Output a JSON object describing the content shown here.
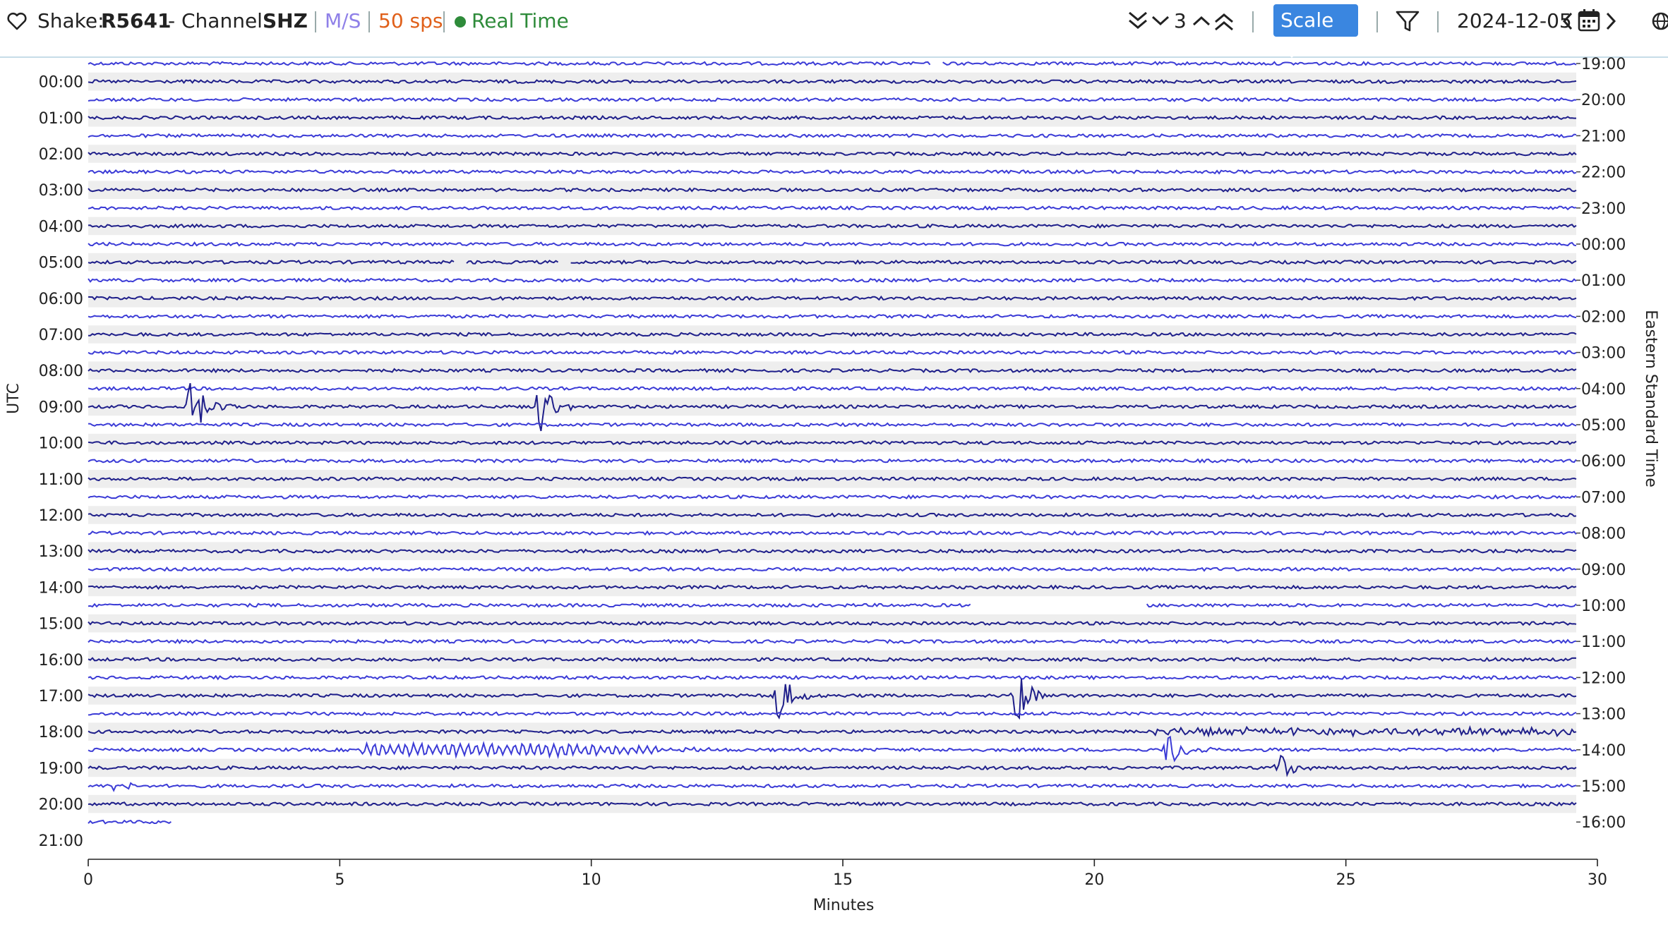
{
  "header": {
    "shake_label": "Shake:",
    "station": "R5641",
    "channel_label": "- Channel:",
    "channel": "SHZ",
    "units": "M/S",
    "rate": "50 sps",
    "mode": "Real Time",
    "lines_count": "3",
    "scale_label": "Scale",
    "date": "2024-12-05",
    "colors": {
      "units": "#8f80e8",
      "rate": "#e0601a",
      "mode": "#2e8b3a",
      "scale_bg": "#3a86e0",
      "trace_dark": "#1f1f8a",
      "trace_light": "#3b3bd6"
    },
    "icons": [
      "heart-icon",
      "double-chevron-down-icon",
      "chevron-down-icon",
      "chevron-up-icon",
      "double-chevron-up-icon",
      "filter-icon",
      "chevron-left-icon",
      "calendar-icon",
      "chevron-right-icon",
      "globe-icon"
    ]
  },
  "chart_data": {
    "type": "line",
    "title": "",
    "xlabel": "Minutes",
    "ylabel_left": "UTC",
    "ylabel_right": "Eastern Standard Time",
    "xlim": [
      0,
      30
    ],
    "x_ticks": [
      0,
      5,
      10,
      15,
      20,
      25,
      30
    ],
    "row_minutes": 30,
    "row_count": 43,
    "left_labels": [
      "00:00",
      "01:00",
      "02:00",
      "03:00",
      "04:00",
      "05:00",
      "06:00",
      "07:00",
      "08:00",
      "09:00",
      "10:00",
      "11:00",
      "12:00",
      "13:00",
      "14:00",
      "15:00",
      "16:00",
      "17:00",
      "18:00",
      "19:00",
      "20:00",
      "21:00"
    ],
    "right_labels": [
      "19:00",
      "20:00",
      "21:00",
      "22:00",
      "23:00",
      "00:00",
      "01:00",
      "02:00",
      "03:00",
      "04:00",
      "05:00",
      "06:00",
      "07:00",
      "08:00",
      "09:00",
      "10:00",
      "11:00",
      "12:00",
      "13:00",
      "14:00",
      "15:00",
      "16:00"
    ],
    "events": [
      {
        "row": 19,
        "minute": 2.1,
        "amplitude": 3.5
      },
      {
        "row": 19,
        "minute": 9.1,
        "amplitude": 3.4
      },
      {
        "row": 35,
        "minute": 13.9,
        "amplitude": 3.0
      },
      {
        "row": 35,
        "minute": 18.7,
        "amplitude": 3.3
      },
      {
        "row": 38,
        "minute": 21.8,
        "amplitude": 2.5
      },
      {
        "row": 39,
        "minute": 24.0,
        "amplitude": 1.6
      },
      {
        "row": 40,
        "minute": 0.6,
        "amplitude": 1.2
      }
    ],
    "gaps": [
      {
        "row": 0,
        "from": 17.0,
        "to": 17.2
      },
      {
        "row": 11,
        "from": 7.4,
        "to": 7.6
      },
      {
        "row": 11,
        "from": 9.5,
        "to": 9.7
      },
      {
        "row": 30,
        "from": 17.8,
        "to": 21.3
      }
    ],
    "data_ends": {
      "row": 42,
      "minute": 1.7
    }
  }
}
